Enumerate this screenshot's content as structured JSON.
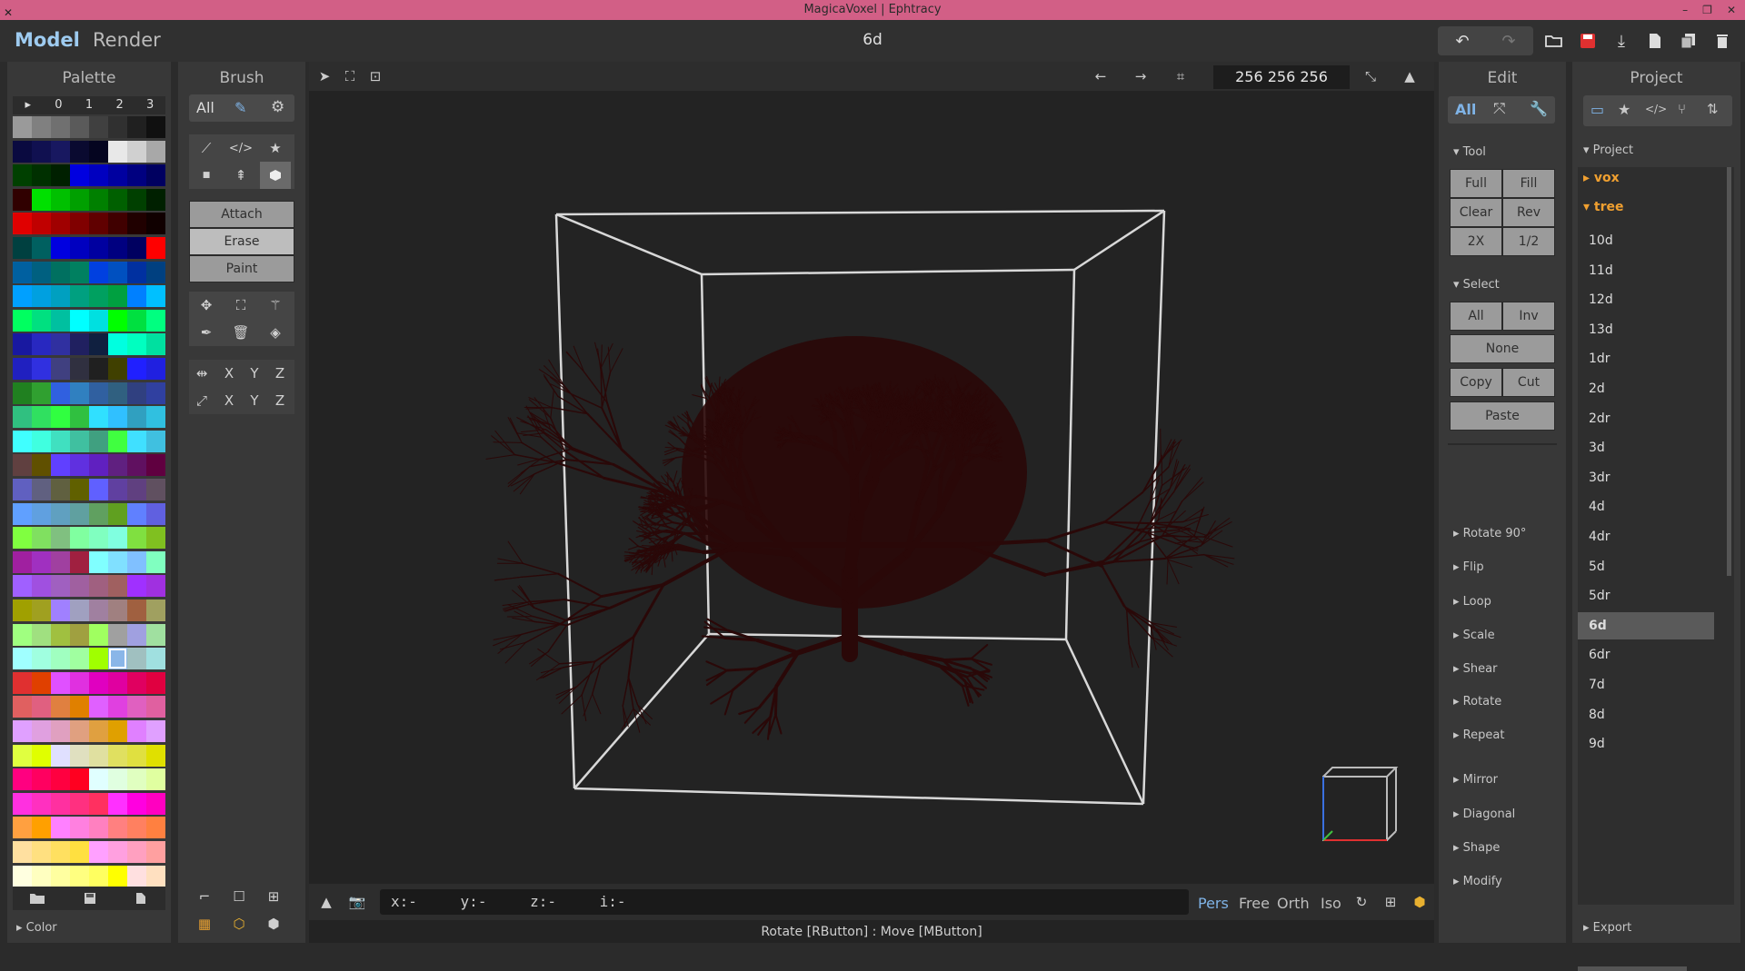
{
  "window": {
    "title": "MagicaVoxel | Ephtracy"
  },
  "header": {
    "mode_model": "Model",
    "mode_render": "Render",
    "filename": "6d"
  },
  "palette": {
    "title": "Palette",
    "tabs": [
      "▸",
      "0",
      "1",
      "2",
      "3"
    ],
    "footer_section": "Color",
    "selected_color": "#8ab6e8",
    "colors": [
      [
        "#9a9a9a",
        "#808080",
        "#707070",
        "#5a5a5a",
        "#404040",
        "#303030",
        "#202020",
        "#101010"
      ],
      [
        "#0a0a40",
        "#101050",
        "#181860",
        "#0a0a30",
        "#050520",
        "#e8e8e8",
        "#d0d0d0",
        "#a8a8a8"
      ],
      [
        "#004000",
        "#003000",
        "#002000",
        "#0000e0",
        "#0000c0",
        "#0000a0",
        "#000080",
        "#000060"
      ],
      [
        "#300000",
        "#00e000",
        "#00c000",
        "#00a000",
        "#008000",
        "#006000",
        "#004000",
        "#002000"
      ],
      [
        "#e00000",
        "#c00000",
        "#a00000",
        "#800000",
        "#600000",
        "#400000",
        "#200000",
        "#100000"
      ],
      [
        "#004040",
        "#006060",
        "#0000e0",
        "#0000c0",
        "#0000a0",
        "#000080",
        "#000060",
        "#ff0000"
      ],
      [
        "#0060a0",
        "#006080",
        "#007060",
        "#008060",
        "#0040e0",
        "#0050c0",
        "#0030a0",
        "#004080"
      ],
      [
        "#00a0ff",
        "#00a0e0",
        "#00a0c0",
        "#00a080",
        "#00a060",
        "#00a040",
        "#0080ff",
        "#00c0ff"
      ],
      [
        "#00ff60",
        "#00e080",
        "#00c0a0",
        "#00ffff",
        "#00e0e0",
        "#00ff00",
        "#00e040",
        "#00ff80"
      ],
      [
        "#1818a0",
        "#2828c0",
        "#3030a0",
        "#202060",
        "#102040",
        "#00ffe0",
        "#00ffc0",
        "#00e0a0"
      ],
      [
        "#2020c0",
        "#3030e0",
        "#404080",
        "#303040",
        "#202020",
        "#404000",
        "#2020ff",
        "#2020e0"
      ],
      [
        "#208020",
        "#30a030",
        "#3060e0",
        "#3080c0",
        "#3060a0",
        "#306080",
        "#304080",
        "#3040a0"
      ],
      [
        "#30c080",
        "#30e060",
        "#30ff40",
        "#30c040",
        "#30e0ff",
        "#30c0ff",
        "#30a0c0",
        "#30c0e0"
      ],
      [
        "#40ffff",
        "#40ffe0",
        "#40e0c0",
        "#40c0a0",
        "#40a080",
        "#40ff40",
        "#40e0ff",
        "#40c0e0"
      ],
      [
        "#604040",
        "#605000",
        "#6040ff",
        "#6030e0",
        "#6020c0",
        "#602080",
        "#601060",
        "#600040"
      ],
      [
        "#6060c0",
        "#606080",
        "#606040",
        "#606000",
        "#6060ff",
        "#6040a0",
        "#604080",
        "#605060"
      ],
      [
        "#60a0ff",
        "#60a0e0",
        "#60a0c0",
        "#60a0a0",
        "#60a060",
        "#60a020",
        "#6080ff",
        "#6060e0"
      ],
      [
        "#80ff40",
        "#80e060",
        "#80c080",
        "#80ffa0",
        "#80ffc0",
        "#80ffe0",
        "#80e040",
        "#80c020"
      ],
      [
        "#a020a0",
        "#a030c0",
        "#a040a0",
        "#a02040",
        "#80ffff",
        "#80e0ff",
        "#80c0ff",
        "#80ffc0"
      ],
      [
        "#a060ff",
        "#a050e0",
        "#a060c0",
        "#a060a0",
        "#a06080",
        "#a06060",
        "#a030ff",
        "#a030e0"
      ],
      [
        "#a0a000",
        "#a0a020",
        "#a080ff",
        "#a0a0c0",
        "#a080a0",
        "#a08080",
        "#a06040",
        "#a0a060"
      ],
      [
        "#a0ff80",
        "#a0e080",
        "#a0c040",
        "#a0a040",
        "#a0ff60",
        "#a0a0a0",
        "#a0a0e0",
        "#a0e0a0"
      ],
      [
        "#a0ffff",
        "#a0ffe0",
        "#a0ffc0",
        "#a0ffa0",
        "#a0ff00",
        "#8ab6e8",
        "#a0c0c0",
        "#a0e0e0"
      ],
      [
        "#e03030",
        "#e04000",
        "#e050ff",
        "#e030e0",
        "#e000c0",
        "#e000a0",
        "#e00060",
        "#e00040"
      ],
      [
        "#e06060",
        "#e06080",
        "#e08040",
        "#e08000",
        "#e060ff",
        "#e040e0",
        "#e060c0",
        "#e060a0"
      ],
      [
        "#e0a0ff",
        "#e0a0e0",
        "#e0a0c0",
        "#e0a080",
        "#e0a040",
        "#e0a000",
        "#e080ff",
        "#e0a0ff"
      ],
      [
        "#e0ff40",
        "#e0ff00",
        "#e0e0ff",
        "#e0e0c0",
        "#e0e0a0",
        "#e0e060",
        "#e0e040",
        "#e0e000"
      ],
      [
        "#ff0080",
        "#ff0060",
        "#ff0040",
        "#ff0020",
        "#e0ffff",
        "#e0ffe0",
        "#e0ffc0",
        "#e0ffa0"
      ],
      [
        "#ff30e0",
        "#ff30c0",
        "#ff30a0",
        "#ff3080",
        "#ff3060",
        "#ff30ff",
        "#ff00e0",
        "#ff00c0"
      ],
      [
        "#ffa040",
        "#ffa000",
        "#ff80ff",
        "#ff80e0",
        "#ff80c0",
        "#ff8080",
        "#ff8060",
        "#ff8040"
      ],
      [
        "#ffe0a0",
        "#ffe080",
        "#ffe060",
        "#ffe040",
        "#ffa0ff",
        "#ffa0e0",
        "#ffa0c0",
        "#ffa0a0"
      ],
      [
        "#ffffe0",
        "#ffffc0",
        "#ffffa0",
        "#ffff80",
        "#ffff60",
        "#ffff00",
        "#ffe0e0",
        "#ffe0c0"
      ]
    ]
  },
  "brush": {
    "title": "Brush",
    "filter_all": "All",
    "actions": [
      "Attach",
      "Erase",
      "Paint"
    ],
    "axis_labels": [
      "X",
      "Y",
      "Z"
    ]
  },
  "viewport": {
    "dimensions": "256  256  256",
    "coords": {
      "x": "x:-",
      "y": "y:-",
      "z": "z:-",
      "i": "i:-"
    },
    "view_modes": [
      "Pers",
      "Free",
      "Orth",
      "Iso"
    ],
    "active_view": "Pers",
    "status": "Rotate [RButton] : Move [MButton]",
    "model_color": "#2a0808"
  },
  "edit": {
    "title": "Edit",
    "filter_all": "All",
    "tool_section": "Tool",
    "tool_buttons": [
      "Full",
      "Fill",
      "Clear",
      "Rev",
      "2X",
      "1/2"
    ],
    "select_section": "Select",
    "select_buttons": [
      "All",
      "Inv",
      "None",
      "Copy",
      "Cut",
      "Paste"
    ],
    "collapsible": [
      "Rotate 90°",
      "Flip",
      "Loop",
      "Scale",
      "Shear",
      "Rotate",
      "Repeat",
      "Mirror",
      "Diagonal",
      "Shape",
      "Modify"
    ]
  },
  "project": {
    "title": "Project",
    "section": "Project",
    "folders": [
      "vox",
      "tree"
    ],
    "items": [
      "10d",
      "11d",
      "12d",
      "13d",
      "1dr",
      "2d",
      "2dr",
      "3d",
      "3dr",
      "4d",
      "4dr",
      "5d",
      "5dr",
      "6d",
      "6dr",
      "7d",
      "8d",
      "9d"
    ],
    "selected": "6d",
    "footer_section": "Export"
  },
  "colors": {
    "titlebar": "#d25f86",
    "accent": "#9ecbf0",
    "folder": "#f0a030",
    "save_icon": "#e03030"
  }
}
